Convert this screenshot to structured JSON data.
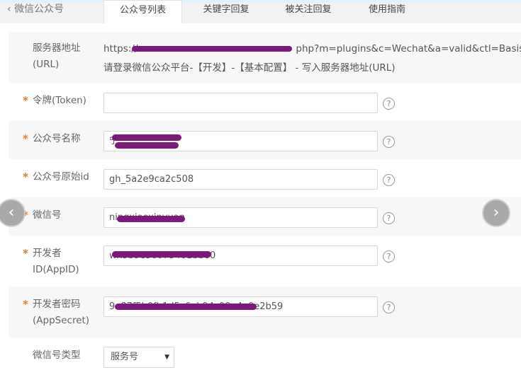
{
  "header": {
    "back_label": "微信公众号",
    "tabs": [
      {
        "label": "公众号列表"
      },
      {
        "label": "关键字回复"
      },
      {
        "label": "被关注回复"
      },
      {
        "label": "使用指南"
      }
    ]
  },
  "form": {
    "server_url": {
      "label_line1": "服务器地址",
      "label_line2": "(URL)",
      "value_prefix": "https://",
      "value_suffix": "php?m=plugins&c=Wechat&a=valid&ctl=Basis&",
      "hint": "请登录微信公众平台-【开发】-【基本配置】 - 写入服务器地址(URL)"
    },
    "token": {
      "required": "*",
      "label": "令牌(Token)",
      "value": ""
    },
    "account_name": {
      "required": "*",
      "label": "公众号名称",
      "value": "宁"
    },
    "original_id": {
      "required": "*",
      "label": "公众号原始id",
      "value": "gh_5a2e9ca2c508"
    },
    "wechat_id": {
      "required": "*",
      "label": "微信号",
      "value": "ningxiaoxinyuan"
    },
    "app_id": {
      "required": "*",
      "label_line1": "开发者",
      "label_line2": "ID(AppID)",
      "value": "wx5b9e36073461bb60"
    },
    "app_secret": {
      "required": "*",
      "label_line1": "开发者密码",
      "label_line2": "(AppSecret)",
      "value": "9e87f5b0fb1d5c6eb94c99e4a0e2b59"
    },
    "account_type": {
      "label": "微信号类型",
      "selected": "服务号"
    },
    "help_glyph": "?"
  },
  "nav": {
    "prev_glyph": "‹",
    "next_glyph": "›"
  }
}
